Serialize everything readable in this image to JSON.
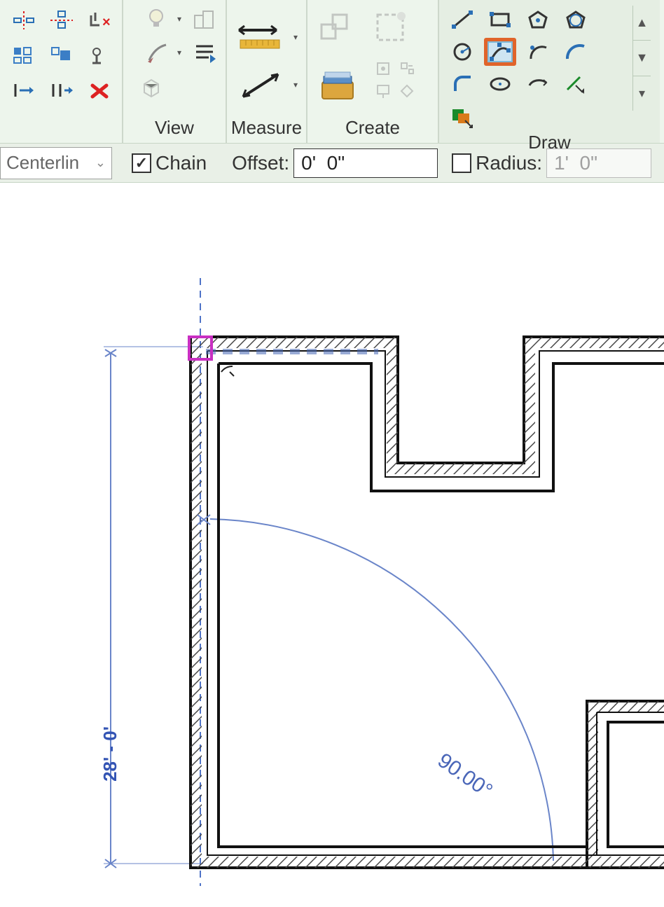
{
  "ribbon": {
    "panels": {
      "view": {
        "label": "View"
      },
      "measure": {
        "label": "Measure"
      },
      "create": {
        "label": "Create"
      },
      "draw": {
        "label": "Draw"
      }
    }
  },
  "options": {
    "location_line": "Centerlin",
    "chain_label": "Chain",
    "chain_checked": true,
    "offset_label": "Offset:",
    "offset_value": "0'  0\"",
    "radius_label": "Radius:",
    "radius_checked": false,
    "radius_value": "1'  0\""
  },
  "drawing": {
    "dim_extension_length": "28' - 0'",
    "angle_label": "90.00°"
  },
  "icons": {
    "scroll_up": "▲",
    "scroll_mid": "▼",
    "scroll_drop": "▾",
    "checkmark": "✓",
    "chev": "⌄",
    "dd": "▾"
  }
}
